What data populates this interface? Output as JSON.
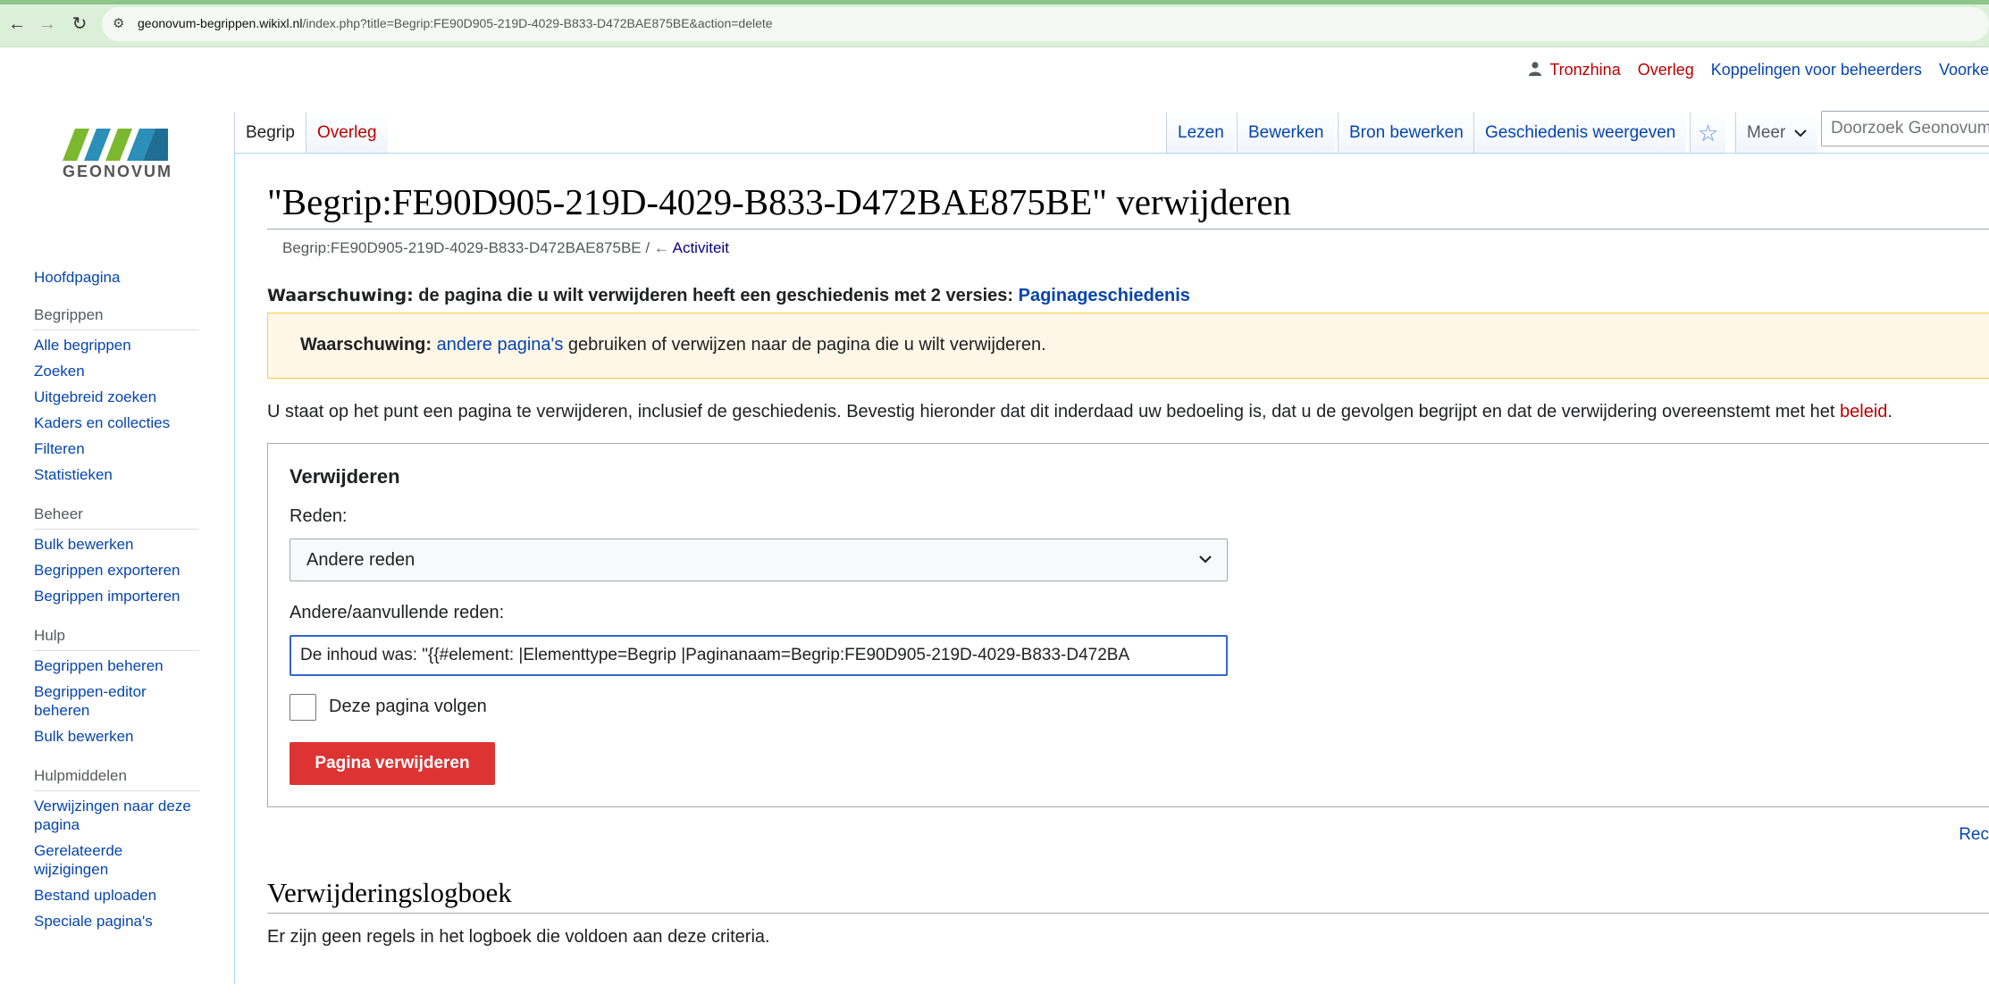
{
  "browser": {
    "url_host": "geonovum-begrippen.wikixl.nl",
    "url_path": "/index.php?title=Begrip:FE90D905-219D-4029-B833-D472BAE875BE&action=delete"
  },
  "personal_tools": {
    "username": "Tronzhina",
    "talk": "Overleg",
    "admin_links": "Koppelingen voor beheerders",
    "preferences": "Voorke"
  },
  "logo": {
    "text": "GEONOVUM"
  },
  "sidebar": {
    "main_link": "Hoofdpagina",
    "groups": [
      {
        "heading": "Begrippen",
        "items": [
          "Alle begrippen",
          "Zoeken",
          "Uitgebreid zoeken",
          "Kaders en collecties",
          "Filteren",
          "Statistieken"
        ]
      },
      {
        "heading": "Beheer",
        "items": [
          "Bulk bewerken",
          "Begrippen exporteren",
          "Begrippen importeren"
        ]
      },
      {
        "heading": "Hulp",
        "items": [
          "Begrippen beheren",
          "Begrippen-editor beheren",
          "Bulk bewerken"
        ]
      },
      {
        "heading": "Hulpmiddelen",
        "items": [
          "Verwijzingen naar deze pagina",
          "Gerelateerde wijzigingen",
          "Bestand uploaden",
          "Speciale pagina's"
        ]
      }
    ]
  },
  "tabs": {
    "page": "Begrip",
    "talk": "Overleg",
    "read": "Lezen",
    "edit": "Bewerken",
    "edit_source": "Bron bewerken",
    "history": "Geschiedenis weergeven",
    "more": "Meer",
    "search_placeholder": "Doorzoek Geonovum"
  },
  "content": {
    "title": "\"Begrip:FE90D905-219D-4029-B833-D472BAE875BE\" verwijderen",
    "subtitle_page": "Begrip:FE90D905-219D-4029-B833-D472BAE875BE",
    "subtitle_sep": " / ← ",
    "subtitle_link": "Activiteit",
    "history_warning_bold": "Waarschuwing:",
    "history_warning_text": " de pagina die u wilt verwijderen heeft een geschiedenis met 2 versies: ",
    "history_warning_link": "Paginageschiedenis",
    "box_warning_bold": "Waarschuwing:",
    "box_warning_link": "andere pagina's",
    "box_warning_text": " gebruiken of verwijzen naar de pagina die u wilt verwijderen.",
    "intro_text": "U staat op het punt een pagina te verwijderen, inclusief de geschiedenis. Bevestig hieronder dat dit inderdaad uw bedoeling is, dat u de gevolgen begrijpt en dat de verwijdering overeenstemt met het ",
    "intro_link": "beleid",
    "intro_end": ".",
    "right_cut_link": "Rec",
    "log_heading": "Verwijderingslogboek",
    "log_empty": "Er zijn geen regels in het logboek die voldoen aan deze criteria."
  },
  "form": {
    "legend": "Verwijderen",
    "reason_label": "Reden:",
    "reason_value": "Andere reden",
    "other_label": "Andere/aanvullende reden:",
    "other_value": "De inhoud was: \"{{#element: |Elementtype=Begrip |Paginanaam=Begrip:FE90D905-219D-4029-B833-D472BA",
    "watch_label": "Deze pagina volgen",
    "submit_label": "Pagina verwijderen"
  }
}
